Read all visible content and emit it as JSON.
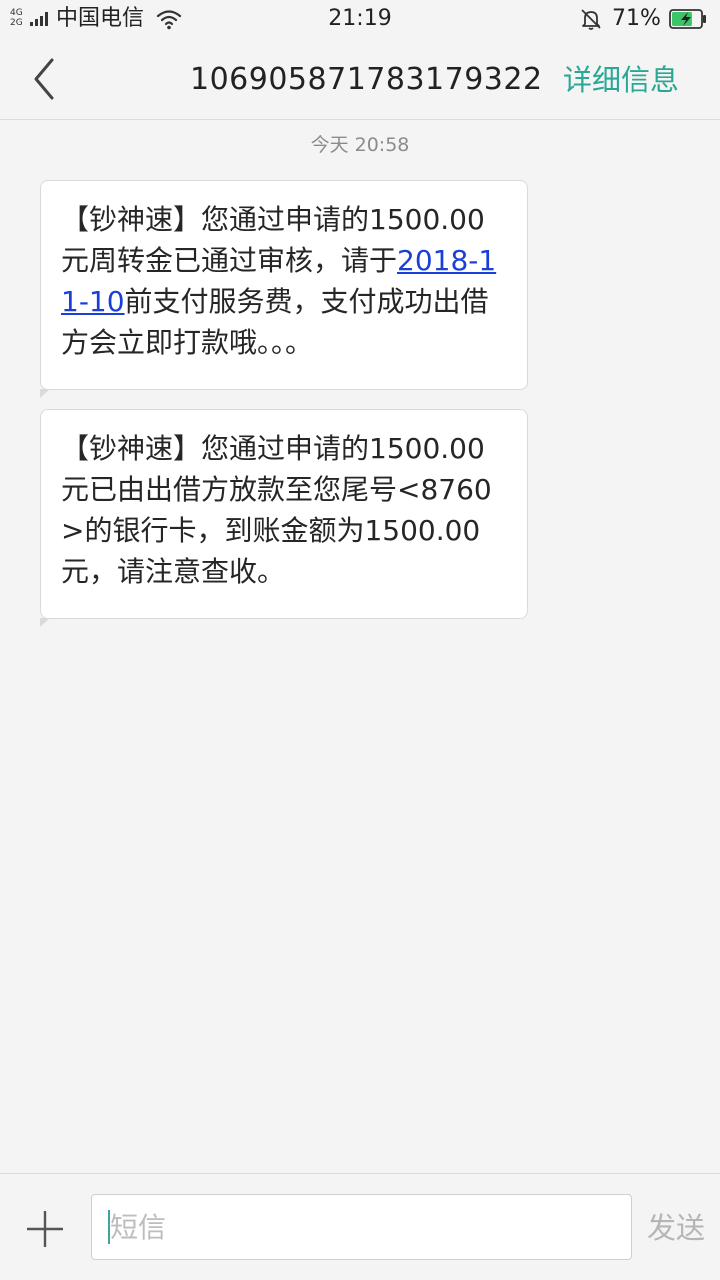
{
  "status_bar": {
    "network_label_top": "4G",
    "network_label_bottom": "2G",
    "carrier": "中国电信",
    "time": "21:19",
    "battery_percent": "71%",
    "battery_level": 0.71,
    "battery_color": "#3cc46a",
    "icons": [
      "signal-icon",
      "wifi-icon",
      "mute-bell-icon",
      "battery-charging-icon"
    ]
  },
  "header": {
    "back_icon": "chevron-left-icon",
    "contact_number": "106905871783179322",
    "detail_label": "详细信息",
    "accent_color": "#2aa896"
  },
  "thread": {
    "timestamp": "今天  20:58",
    "messages": [
      {
        "before_link": "【钞神速】您通过申请的1500.00元周转金已通过审核，请于",
        "link": "2018-11-10",
        "after_link": "前支付服务费，支付成功出借方会立即打款哦。。。"
      },
      {
        "text": "【钞神速】您通过申请的1500.00元已由出借方放款至您尾号<8760>的银行卡，到账金额为1500.00元，请注意查收。"
      }
    ]
  },
  "composer": {
    "add_icon": "plus-icon",
    "placeholder": "短信",
    "value": "",
    "send_label": "发送"
  }
}
